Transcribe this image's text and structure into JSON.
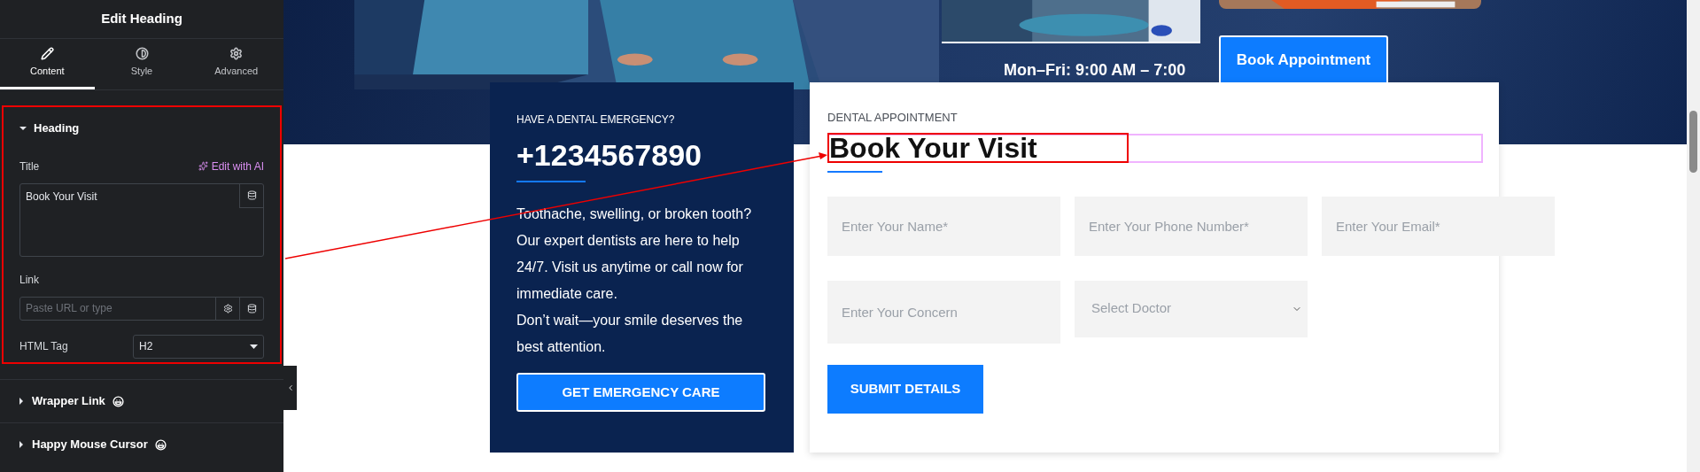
{
  "editor_panel": {
    "title": "Edit Heading",
    "tabs": [
      {
        "label": "Content",
        "selected": true
      },
      {
        "label": "Style",
        "selected": false
      },
      {
        "label": "Advanced",
        "selected": false
      }
    ],
    "section": {
      "title": "Heading",
      "expanded": true,
      "title_label": "Title",
      "ai_link": "Edit with AI",
      "title_value": "Book Your Visit",
      "link_label": "Link",
      "link_placeholder": "Paste URL or type",
      "tag_label": "HTML Tag",
      "tag_value": "H2"
    },
    "collapsed_sections": [
      {
        "title": "Wrapper Link",
        "expanded": false
      },
      {
        "title": "Happy Mouse Cursor",
        "expanded": false
      }
    ]
  },
  "hero": {
    "hours": "Mon–Fri: 9:00 AM – 7:00",
    "button": "Book Appointment"
  },
  "emergency_card": {
    "eyebrow": "HAVE A DENTAL EMERGENCY?",
    "phone": "+1234567890",
    "paragraphs": [
      "Toothache, swelling, or broken tooth? Our expert dentists are here to help 24/7. Visit us anytime or call now for immediate care.",
      "Don’t wait—your smile deserves the best attention."
    ],
    "button": "GET EMERGENCY CARE"
  },
  "appointment_form": {
    "eyebrow": "DENTAL APPOINTMENT",
    "heading": "Book Your Visit",
    "rows": [
      [
        {
          "kind": "input",
          "placeholder": "Enter Your Name*"
        },
        {
          "kind": "input",
          "placeholder": "Enter Your Phone Number*"
        },
        {
          "kind": "input",
          "placeholder": "Enter Your Email*"
        }
      ],
      [
        {
          "kind": "input",
          "placeholder": "Enter Your Concern"
        },
        {
          "kind": "select",
          "value": "Select Doctor"
        }
      ]
    ],
    "button": "SUBMIT DETAILS"
  }
}
